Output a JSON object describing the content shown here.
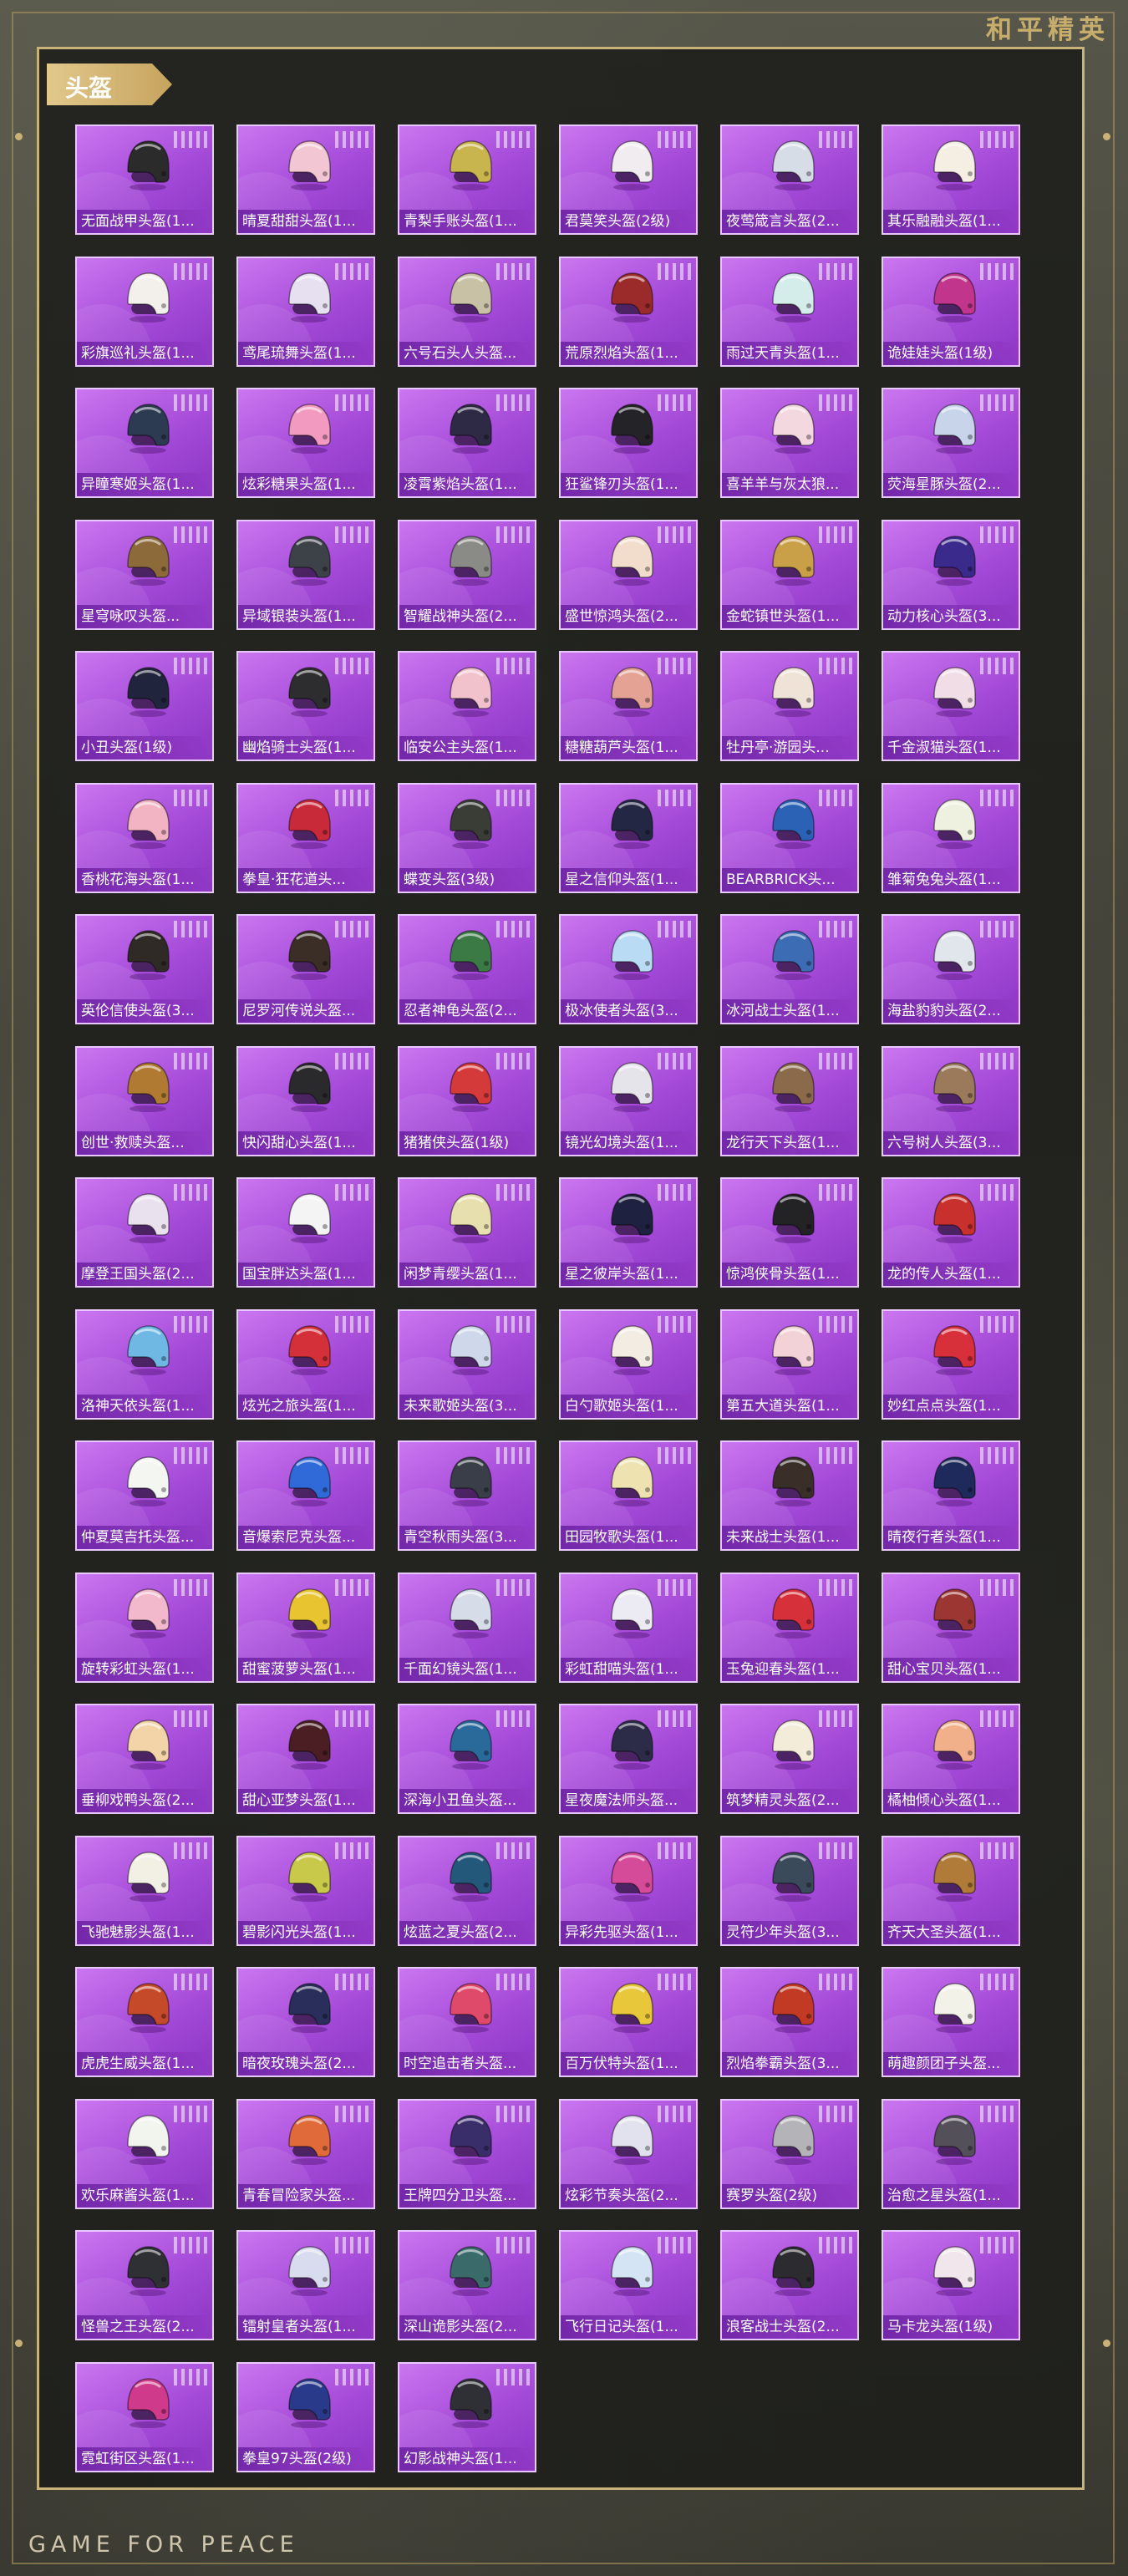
{
  "brand_top": "和平精英",
  "brand_bottom": "GAME FOR PEACE",
  "section_title": "头盔",
  "items": [
    {
      "label": "无面战甲头盔(1...",
      "color": "#2b2b2b"
    },
    {
      "label": "晴夏甜甜头盔(1...",
      "color": "#f3c6d3"
    },
    {
      "label": "青梨手账头盔(1...",
      "color": "#c9b54e"
    },
    {
      "label": "君莫笑头盔(2级)",
      "color": "#f1ecef"
    },
    {
      "label": "夜莺箴言头盔(2...",
      "color": "#d7dde6"
    },
    {
      "label": "其乐融融头盔(1...",
      "color": "#f4eee3"
    },
    {
      "label": "彩旗巡礼头盔(1...",
      "color": "#f3f0ec"
    },
    {
      "label": "鸢尾琉舞头盔(1...",
      "color": "#e6e0f0"
    },
    {
      "label": "六号石头人头盔...",
      "color": "#c8c1a6"
    },
    {
      "label": "荒原烈焰头盔(1...",
      "color": "#9b2a2a"
    },
    {
      "label": "雨过天青头盔(1...",
      "color": "#d4ecea"
    },
    {
      "label": "诡娃娃头盔(1级)",
      "color": "#c2358c"
    },
    {
      "label": "异瞳寒姬头盔(1...",
      "color": "#2c3b52"
    },
    {
      "label": "炫彩糖果头盔(1...",
      "color": "#f29ac0"
    },
    {
      "label": "凌霄紫焰头盔(1...",
      "color": "#2e2a46"
    },
    {
      "label": "狂鲨锋刃头盔(1...",
      "color": "#242428"
    },
    {
      "label": "喜羊羊与灰太狼...",
      "color": "#f3d8e0"
    },
    {
      "label": "荧海星豚头盔(2...",
      "color": "#c7d4ea"
    },
    {
      "label": "星穹咏叹头盔...",
      "color": "#8c6a3a"
    },
    {
      "label": "异域银装头盔(1...",
      "color": "#3d4148"
    },
    {
      "label": "智耀战神头盔(2...",
      "color": "#8a8a86"
    },
    {
      "label": "盛世惊鸿头盔(2...",
      "color": "#f2dccb"
    },
    {
      "label": "金蛇镇世头盔(1...",
      "color": "#c9a048"
    },
    {
      "label": "动力核心头盔(3...",
      "color": "#3a2a8c"
    },
    {
      "label": "小丑头盔(1级)",
      "color": "#20243c"
    },
    {
      "label": "幽焰骑士头盔(1...",
      "color": "#2d2d30"
    },
    {
      "label": "临安公主头盔(1...",
      "color": "#f1c2cc"
    },
    {
      "label": "糖糖葫芦头盔(1...",
      "color": "#e3a294"
    },
    {
      "label": "牡丹亭·游园头...",
      "color": "#efe2d6"
    },
    {
      "label": "千金淑猫头盔(1...",
      "color": "#f1dde6"
    },
    {
      "label": "香桃花海头盔(1...",
      "color": "#f2b3c2"
    },
    {
      "label": "拳皇·狂花道头...",
      "color": "#c92a3a"
    },
    {
      "label": "蝶变头盔(3级)",
      "color": "#3a3d35"
    },
    {
      "label": "星之信仰头盔(1...",
      "color": "#232744"
    },
    {
      "label": "BEARBRICK头...",
      "color": "#2c62b6"
    },
    {
      "label": "雏菊兔兔头盔(1...",
      "color": "#eef1df"
    },
    {
      "label": "英伦信使头盔(3...",
      "color": "#2f2a26"
    },
    {
      "label": "尼罗河传说头盔...",
      "color": "#3a2e26"
    },
    {
      "label": "忍者神龟头盔(2...",
      "color": "#3b7a44"
    },
    {
      "label": "极冰使者头盔(3...",
      "color": "#b9dcf4"
    },
    {
      "label": "冰河战士头盔(1...",
      "color": "#3c6cb4"
    },
    {
      "label": "海盐豹豹头盔(2...",
      "color": "#e1e6ec"
    },
    {
      "label": "创世·救赎头盔...",
      "color": "#b07a32"
    },
    {
      "label": "快闪甜心头盔(1...",
      "color": "#2a2a2c"
    },
    {
      "label": "猪猪侠头盔(1级)",
      "color": "#d43a3a"
    },
    {
      "label": "镜光幻境头盔(1...",
      "color": "#e4e4ea"
    },
    {
      "label": "龙行天下头盔(1...",
      "color": "#8a6a4a"
    },
    {
      "label": "六号树人头盔(3...",
      "color": "#9a7a5a"
    },
    {
      "label": "摩登王国头盔(2...",
      "color": "#e9e2ee"
    },
    {
      "label": "国宝胖达头盔(1...",
      "color": "#f4f4f4"
    },
    {
      "label": "闲梦青缨头盔(1...",
      "color": "#e8dfae"
    },
    {
      "label": "星之彼岸头盔(1...",
      "color": "#1e2140"
    },
    {
      "label": "惊鸿侠骨头盔(1...",
      "color": "#232326"
    },
    {
      "label": "龙的传人头盔(1...",
      "color": "#c8302e"
    },
    {
      "label": "洛神天依头盔(1...",
      "color": "#6fb8e4"
    },
    {
      "label": "炫光之旅头盔(1...",
      "color": "#d4303a"
    },
    {
      "label": "未来歌姬头盔(3...",
      "color": "#cfd8ea"
    },
    {
      "label": "白勺歌姬头盔(1...",
      "color": "#f2ece2"
    },
    {
      "label": "第五大道头盔(1...",
      "color": "#f2d2d6"
    },
    {
      "label": "妙红点点头盔(1...",
      "color": "#d8303a"
    },
    {
      "label": "仲夏莫吉托头盔...",
      "color": "#f4f6f2"
    },
    {
      "label": "音爆索尼克头盔...",
      "color": "#2f6ad8"
    },
    {
      "label": "青空秋雨头盔(3...",
      "color": "#3a3e48"
    },
    {
      "label": "田园牧歌头盔(1...",
      "color": "#ede2b0"
    },
    {
      "label": "未来战士头盔(1...",
      "color": "#3a2f28"
    },
    {
      "label": "晴夜行者头盔(1...",
      "color": "#1e2a5c"
    },
    {
      "label": "旋转彩虹头盔(1...",
      "color": "#f2b8cc"
    },
    {
      "label": "甜蜜菠萝头盔(1...",
      "color": "#e8c430"
    },
    {
      "label": "千面幻镜头盔(1...",
      "color": "#d6dce8"
    },
    {
      "label": "彩虹甜喵头盔(1...",
      "color": "#eceaf2"
    },
    {
      "label": "玉兔迎春头盔(1...",
      "color": "#d6303a"
    },
    {
      "label": "甜心宝贝头盔(1...",
      "color": "#9c3632"
    },
    {
      "label": "垂柳戏鸭头盔(2...",
      "color": "#f2d4a8"
    },
    {
      "label": "甜心亚梦头盔(1...",
      "color": "#4a1e22"
    },
    {
      "label": "深海小丑鱼头盔...",
      "color": "#2a6a9a"
    },
    {
      "label": "星夜魔法师头盔...",
      "color": "#2c2c48"
    },
    {
      "label": "筑梦精灵头盔(2...",
      "color": "#f2ecd8"
    },
    {
      "label": "橘柚倾心头盔(1...",
      "color": "#f2b08a"
    },
    {
      "label": "飞驰魅影头盔(1...",
      "color": "#f2efe4"
    },
    {
      "label": "碧影闪光头盔(1...",
      "color": "#c8c84a"
    },
    {
      "label": "炫蓝之夏头盔(2...",
      "color": "#24587a"
    },
    {
      "label": "异彩先驱头盔(1...",
      "color": "#d64a9a"
    },
    {
      "label": "灵符少年头盔(3...",
      "color": "#3a4a5a"
    },
    {
      "label": "齐天大圣头盔(1...",
      "color": "#b07a38"
    },
    {
      "label": "虎虎生威头盔(1...",
      "color": "#c44a2a"
    },
    {
      "label": "暗夜玫瑰头盔(2...",
      "color": "#2a2e5a"
    },
    {
      "label": "时空追击者头盔...",
      "color": "#e04a6a"
    },
    {
      "label": "百万伏特头盔(1...",
      "color": "#e8c83a"
    },
    {
      "label": "烈焰拳霸头盔(3...",
      "color": "#c23a24"
    },
    {
      "label": "萌趣颜团子头盔...",
      "color": "#f2f2e8"
    },
    {
      "label": "欢乐麻酱头盔(1...",
      "color": "#f2f4ee"
    },
    {
      "label": "青春冒险家头盔...",
      "color": "#e06a3a"
    },
    {
      "label": "王牌四分卫头盔...",
      "color": "#3a2e6a"
    },
    {
      "label": "炫彩节奏头盔(2...",
      "color": "#e2e2ee"
    },
    {
      "label": "赛罗头盔(2级)",
      "color": "#b4b4b8"
    },
    {
      "label": "治愈之星头盔(1...",
      "color": "#54505a"
    },
    {
      "label": "怪兽之王头盔(2...",
      "color": "#2e3034"
    },
    {
      "label": "镭射皇者头盔(1...",
      "color": "#d8dcee"
    },
    {
      "label": "深山诡影头盔(2...",
      "color": "#3a6a6a"
    },
    {
      "label": "飞行日记头盔(1...",
      "color": "#d4e4f4"
    },
    {
      "label": "浪客战士头盔(2...",
      "color": "#2c2c30"
    },
    {
      "label": "马卡龙头盔(1级)",
      "color": "#f0e6ec"
    },
    {
      "label": "霓虹街区头盔(1...",
      "color": "#d03a8a"
    },
    {
      "label": "拳皇97头盔(2级)",
      "color": "#2a3a8a"
    },
    {
      "label": "幻影战神头盔(1...",
      "color": "#2e3036"
    }
  ]
}
